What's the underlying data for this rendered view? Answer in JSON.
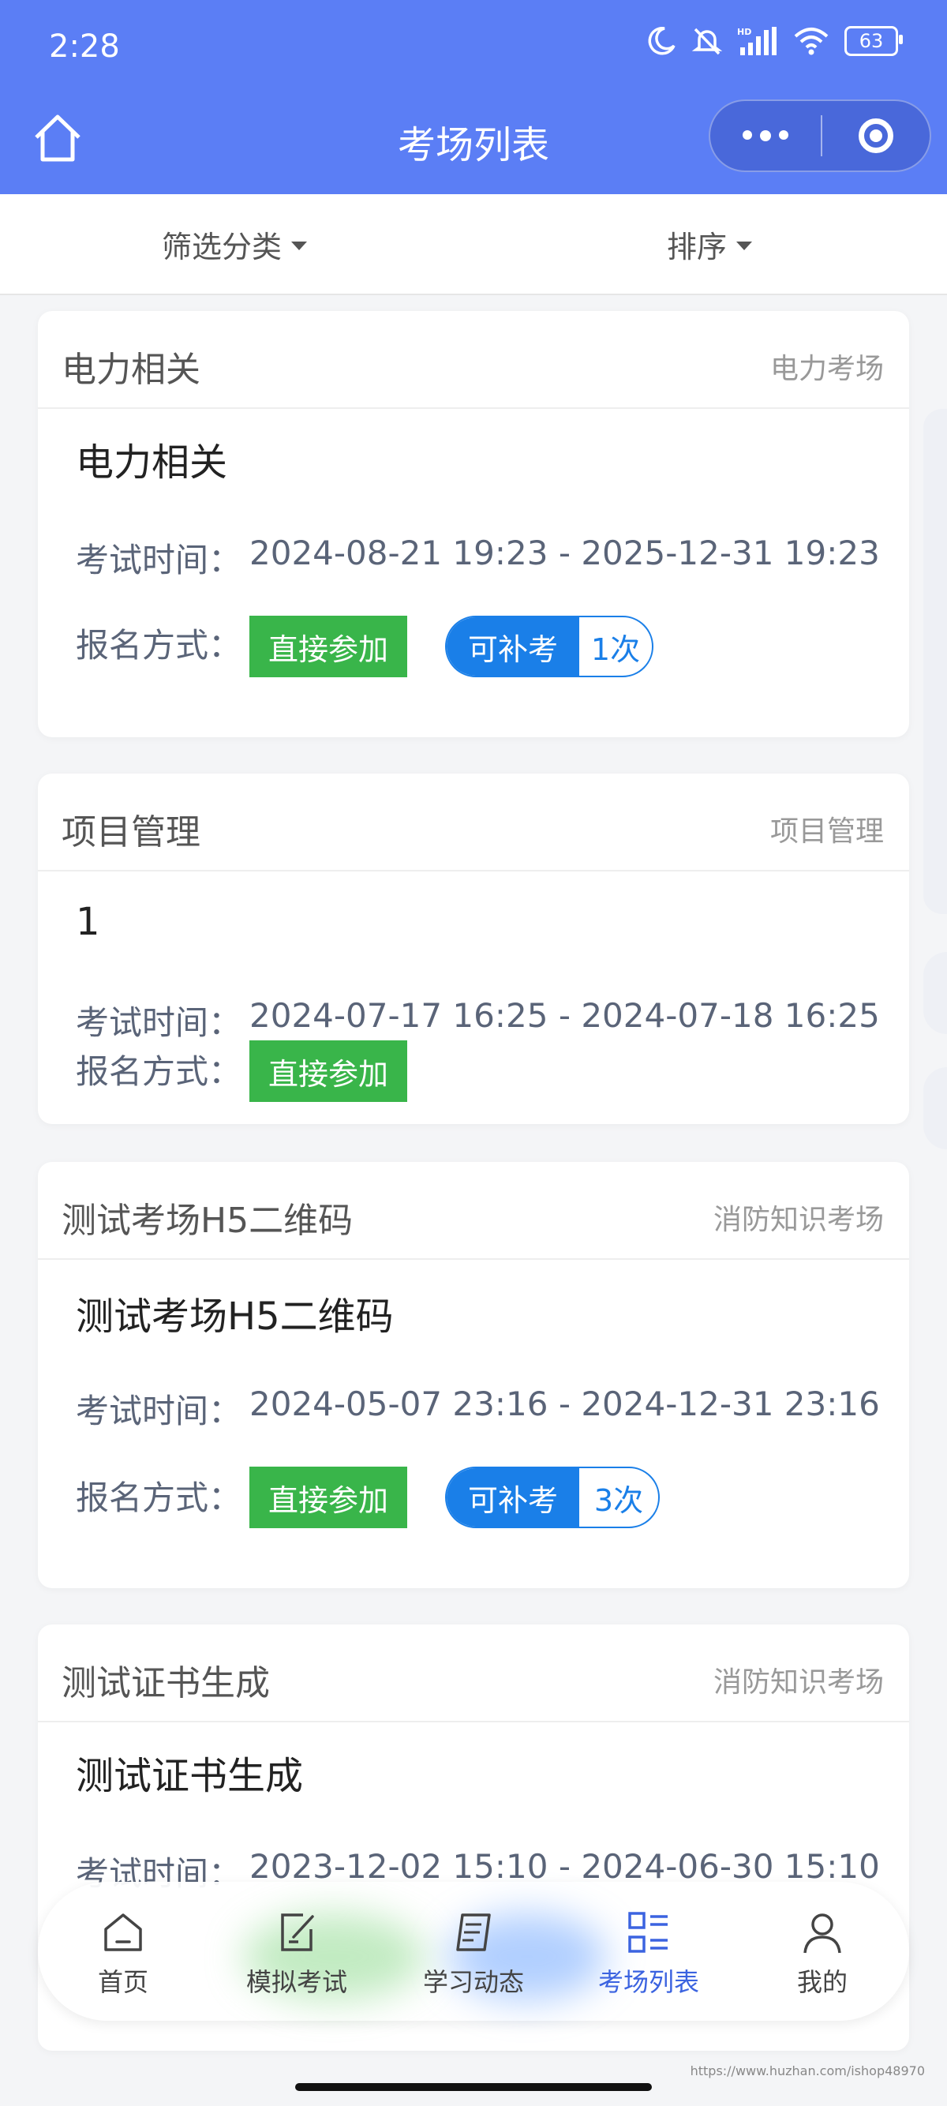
{
  "status_bar": {
    "time": "2:28",
    "battery": "63"
  },
  "nav": {
    "title": "考场列表"
  },
  "filters": {
    "category": "筛选分类",
    "sort": "排序"
  },
  "labels": {
    "exam_time": "考试时间：",
    "signup": "报名方式："
  },
  "cards": [
    {
      "name": "电力相关",
      "category": "电力考场",
      "title": "电力相关",
      "time": "2024-08-21 19:23 - 2025-12-31 19:23",
      "signup": "直接参加",
      "retake": "可补考",
      "retake_count": "1次"
    },
    {
      "name": "项目管理",
      "category": "项目管理",
      "title": "1",
      "time": "2024-07-17 16:25 - 2024-07-18 16:25",
      "signup": "直接参加"
    },
    {
      "name": "测试考场H5二维码",
      "category": "消防知识考场",
      "title": "测试考场H5二维码",
      "time": "2024-05-07 23:16 - 2024-12-31 23:16",
      "signup": "直接参加",
      "retake": "可补考",
      "retake_count": "3次"
    },
    {
      "name": "测试证书生成",
      "category": "消防知识考场",
      "title": "测试证书生成",
      "time": "2023-12-02 15:10 - 2024-06-30 15:10"
    }
  ],
  "tabs": [
    {
      "label": "首页",
      "icon": "home-icon"
    },
    {
      "label": "模拟考试",
      "icon": "edit-icon"
    },
    {
      "label": "学习动态",
      "icon": "notes-icon"
    },
    {
      "label": "考场列表",
      "icon": "list-icon",
      "active": true
    },
    {
      "label": "我的",
      "icon": "user-icon"
    }
  ],
  "watermark": "https://www.huzhan.com/ishop48970",
  "colors": {
    "primary": "#5b7ef5",
    "green_tag": "#39b54a",
    "blue_pill": "#1a7fe8",
    "active_tab": "#3b63e0"
  }
}
